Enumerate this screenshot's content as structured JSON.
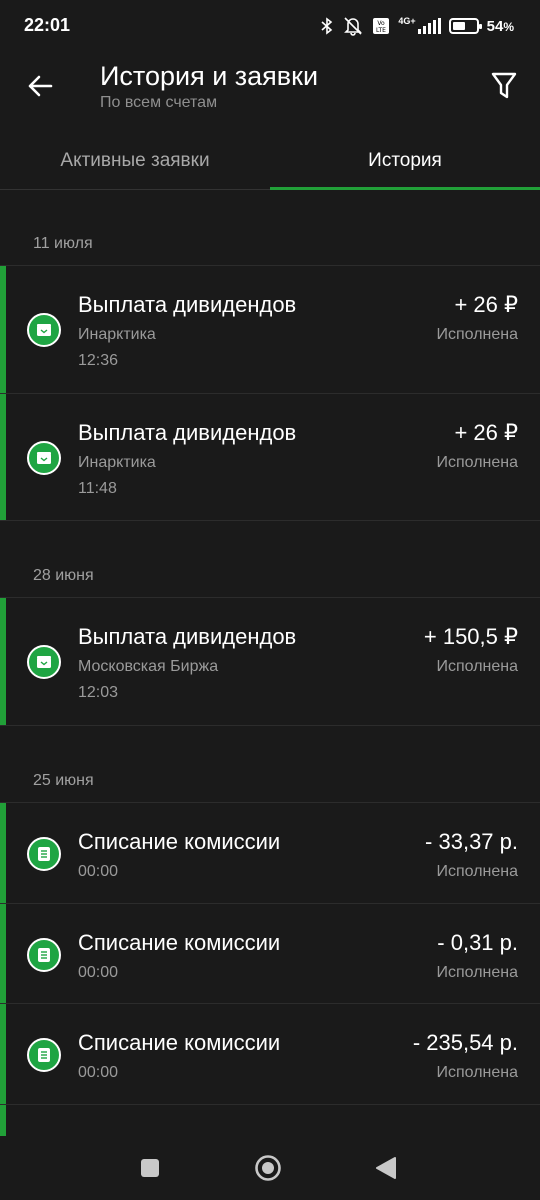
{
  "status_bar": {
    "time": "22:01",
    "battery_percent": "54",
    "battery_suffix": "%",
    "network": "4G+",
    "volte": "Vo LTE",
    "battery_level": 0.54
  },
  "header": {
    "title": "История и заявки",
    "subtitle": "По всем счетам"
  },
  "tabs": [
    {
      "label": "Активные заявки",
      "active": false
    },
    {
      "label": "История",
      "active": true
    }
  ],
  "groups": [
    {
      "date": "11 июля",
      "items": [
        {
          "type": "dividend",
          "title": "Выплата дивидендов",
          "subtitle": "Инарктика",
          "time": "12:36",
          "amount": "+ 26 ₽",
          "status": "Исполнена"
        },
        {
          "type": "dividend",
          "title": "Выплата дивидендов",
          "subtitle": "Инарктика",
          "time": "11:48",
          "amount": "+ 26 ₽",
          "status": "Исполнена"
        }
      ]
    },
    {
      "date": "28 июня",
      "items": [
        {
          "type": "dividend",
          "title": "Выплата дивидендов",
          "subtitle": "Московская Биржа",
          "time": "12:03",
          "amount": "+ 150,5 ₽",
          "status": "Исполнена"
        }
      ]
    },
    {
      "date": "25 июня",
      "items": [
        {
          "type": "commission",
          "title": "Списание комиссии",
          "subtitle": "",
          "time": "00:00",
          "amount": "- 33,37 р.",
          "status": "Исполнена"
        },
        {
          "type": "commission",
          "title": "Списание комиссии",
          "subtitle": "",
          "time": "00:00",
          "amount": "- 0,31 р.",
          "status": "Исполнена"
        },
        {
          "type": "commission",
          "title": "Списание комиссии",
          "subtitle": "",
          "time": "00:00",
          "amount": "- 235,54 р.",
          "status": "Исполнена"
        }
      ]
    }
  ],
  "icons": {
    "back": "arrow-left-icon",
    "filter": "funnel-icon",
    "dividend": "wallet-icon",
    "commission": "document-icon",
    "nav_recents": "square-icon",
    "nav_home": "circle-icon",
    "nav_back": "triangle-back-icon"
  },
  "colors": {
    "accent": "#21a038",
    "background": "#1a1a1a",
    "icon_bg": "#1fa543",
    "secondary_text": "#9a9a9a"
  }
}
